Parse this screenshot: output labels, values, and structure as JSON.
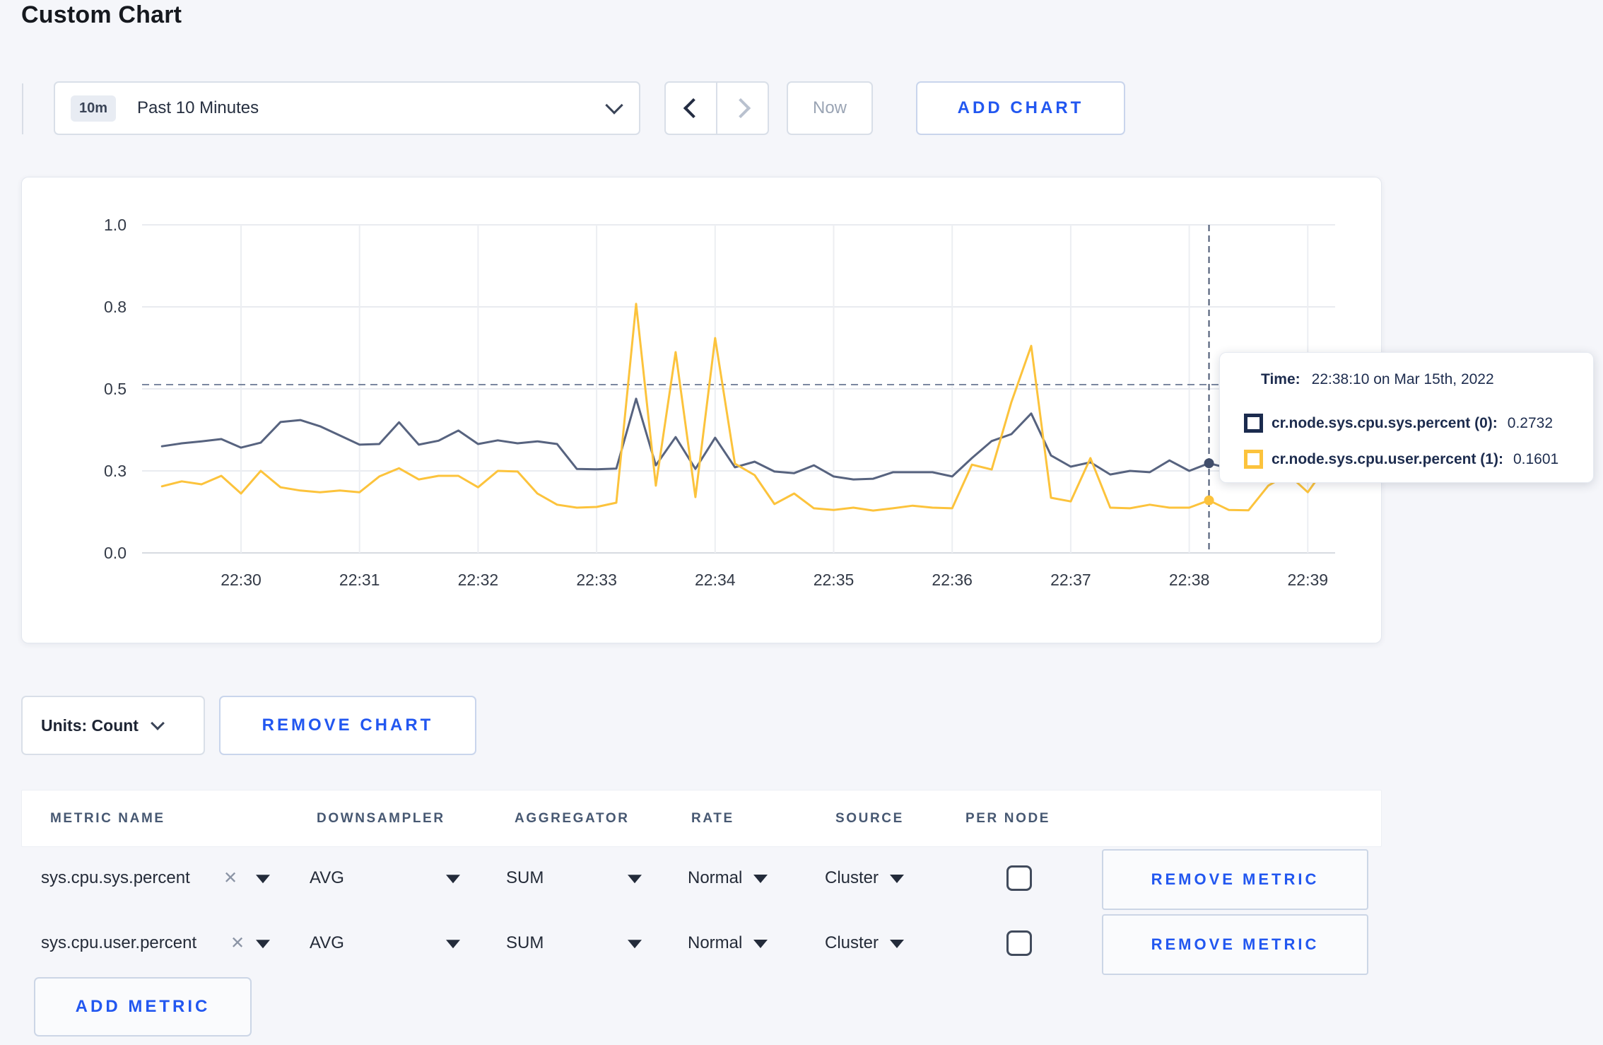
{
  "page": {
    "title": "Custom Chart"
  },
  "toolbar": {
    "time_range_badge": "10m",
    "time_range_label": "Past 10 Minutes",
    "now_label": "Now",
    "add_chart_label": "ADD CHART"
  },
  "chart_data": {
    "type": "line",
    "title": "",
    "xlabel": "",
    "ylabel": "",
    "ylim": [
      0,
      1
    ],
    "grid": true,
    "legend_position": "tooltip-only",
    "y_ticks": [
      {
        "label": "0.0",
        "value": 0
      },
      {
        "label": "0.3",
        "value": 0.25
      },
      {
        "label": "0.5",
        "value": 0.5
      },
      {
        "label": "0.8",
        "value": 0.75
      },
      {
        "label": "1.0",
        "value": 1.0
      }
    ],
    "x_ticks": [
      "22:30",
      "22:31",
      "22:32",
      "22:33",
      "22:34",
      "22:35",
      "22:36",
      "22:37",
      "22:38",
      "22:39"
    ],
    "x_start_time": "22:29:20",
    "x_step_seconds": 10,
    "series": [
      {
        "name": "cr.node.sys.cpu.sys.percent",
        "color": "#57637f",
        "values": [
          0.325,
          0.334,
          0.34,
          0.347,
          0.321,
          0.336,
          0.399,
          0.405,
          0.386,
          0.358,
          0.33,
          0.332,
          0.398,
          0.33,
          0.342,
          0.373,
          0.332,
          0.343,
          0.334,
          0.34,
          0.332,
          0.256,
          0.255,
          0.257,
          0.47,
          0.267,
          0.353,
          0.256,
          0.351,
          0.261,
          0.278,
          0.248,
          0.243,
          0.267,
          0.233,
          0.224,
          0.226,
          0.246,
          0.246,
          0.246,
          0.233,
          0.289,
          0.341,
          0.362,
          0.425,
          0.297,
          0.263,
          0.276,
          0.239,
          0.25,
          0.246,
          0.282,
          0.25,
          0.2732,
          0.258,
          0.268,
          0.262,
          0.272,
          0.285,
          0.3
        ]
      },
      {
        "name": "cr.node.sys.cpu.user.percent",
        "color": "#fcc33c",
        "values": [
          0.203,
          0.218,
          0.209,
          0.235,
          0.181,
          0.25,
          0.2,
          0.19,
          0.185,
          0.19,
          0.185,
          0.233,
          0.258,
          0.224,
          0.235,
          0.235,
          0.2,
          0.25,
          0.248,
          0.181,
          0.147,
          0.138,
          0.14,
          0.153,
          0.759,
          0.205,
          0.612,
          0.17,
          0.655,
          0.272,
          0.237,
          0.149,
          0.181,
          0.136,
          0.131,
          0.138,
          0.129,
          0.136,
          0.144,
          0.138,
          0.136,
          0.269,
          0.254,
          0.46,
          0.631,
          0.168,
          0.157,
          0.289,
          0.138,
          0.136,
          0.147,
          0.138,
          0.138,
          0.1601,
          0.131,
          0.13,
          0.205,
          0.24,
          0.185,
          0.27
        ]
      }
    ],
    "crosshair": {
      "point_index": 53,
      "time": "22:38:10",
      "hline_value": 0.513
    },
    "hover_values": [
      0.2732,
      0.1601
    ]
  },
  "tooltip": {
    "time_label": "Time:",
    "time_value": "22:38:10 on Mar 15th, 2022",
    "rows": [
      {
        "swatch_color": "#1b2b4e",
        "name": "cr.node.sys.cpu.sys.percent (0):",
        "value": "0.2732"
      },
      {
        "swatch_color": "#fcc33c",
        "name": "cr.node.sys.cpu.user.percent (1):",
        "value": "0.1601"
      }
    ]
  },
  "units_bar": {
    "units_label": "Units: Count",
    "remove_chart_label": "REMOVE CHART"
  },
  "metrics_table": {
    "headers": [
      "METRIC NAME",
      "DOWNSAMPLER",
      "AGGREGATOR",
      "RATE",
      "SOURCE",
      "PER NODE"
    ],
    "rows": [
      {
        "metric": "sys.cpu.sys.percent",
        "remove_icon": "✕",
        "downsampler": "AVG",
        "aggregator": "SUM",
        "rate": "Normal",
        "source": "Cluster",
        "per_node_checked": false,
        "remove_label": "REMOVE METRIC"
      },
      {
        "metric": "sys.cpu.user.percent",
        "remove_icon": "✕",
        "downsampler": "AVG",
        "aggregator": "SUM",
        "rate": "Normal",
        "source": "Cluster",
        "per_node_checked": false,
        "remove_label": "REMOVE METRIC"
      }
    ],
    "add_metric_label": "ADD METRIC"
  }
}
